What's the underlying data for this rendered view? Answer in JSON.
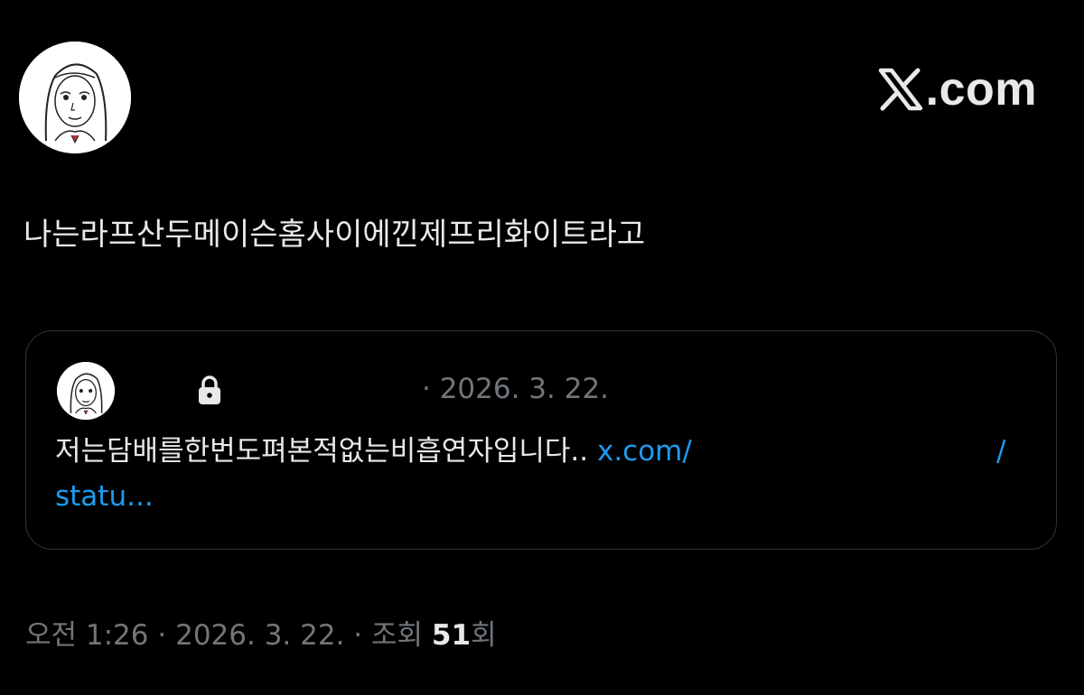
{
  "brand": {
    "logo_icon": "x-logo-icon",
    "text": ".com"
  },
  "tweet": {
    "author_avatar": "avatar",
    "text": "나는라프산두메이슨홈사이에낀제프리화이트라고",
    "time": "오전 1:26",
    "separator": "·",
    "date": "2026. 3. 22.",
    "views_label": "조회",
    "views_count": "51",
    "views_suffix": "회"
  },
  "quote": {
    "author_avatar": "avatar",
    "lock_icon": "lock-icon",
    "date": "· 2026. 3. 22.",
    "text": "저는담배를한번도펴본적없는비흡연자입니다..",
    "link_start": "x.com/",
    "link_slash": "/",
    "link_end": "statu..."
  },
  "colors": {
    "background": "#000000",
    "text": "#e7e9ea",
    "muted": "#71767b",
    "link": "#1d9bf0",
    "border": "#2f3336"
  }
}
